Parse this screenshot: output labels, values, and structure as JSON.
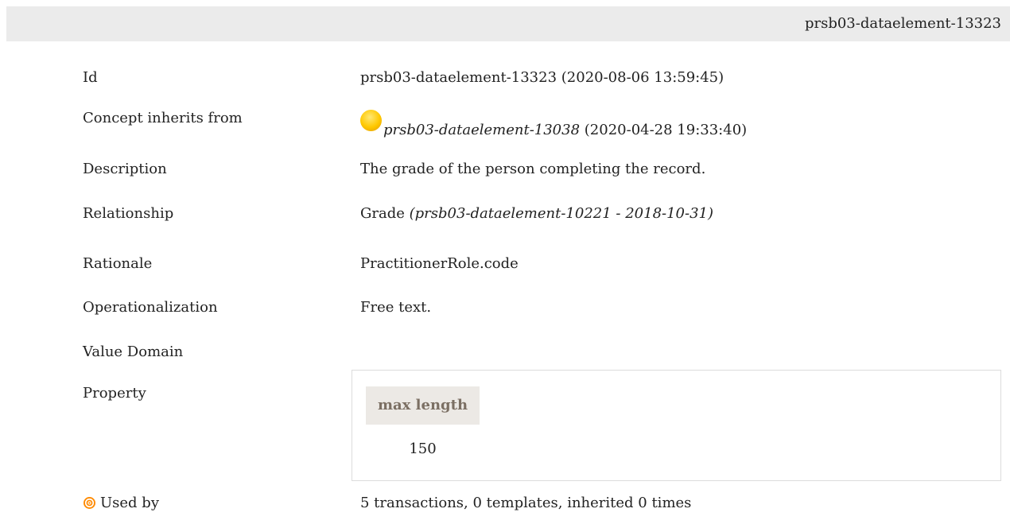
{
  "header": {
    "id": "prsb03-dataelement-13323"
  },
  "rows": {
    "id": {
      "label": "Id",
      "value": "prsb03-dataelement-13323 (2020-08-06 13:59:45)"
    },
    "inherits": {
      "label": "Concept inherits from",
      "icon": "concept-orange-circle-icon",
      "link": "prsb03-dataelement-13038",
      "date": "(2020-04-28 19:33:40)"
    },
    "description": {
      "label": "Description",
      "value": "The grade of the person completing the record."
    },
    "relationship": {
      "label": "Relationship",
      "value": "Grade",
      "detail": "(prsb03-dataelement-10221 - 2018-10-31)"
    },
    "rationale": {
      "label": "Rationale",
      "value": "PractitionerRole.code"
    },
    "operationalization": {
      "label": "Operationalization",
      "value": "Free text."
    },
    "value_domain": {
      "label": "Value Domain"
    },
    "property": {
      "label": "Property",
      "column_header": "max length",
      "column_value": "150"
    },
    "used_by": {
      "icon": "target-icon",
      "label": "Used by",
      "value": "5 transactions, 0 templates, inherited 0 times"
    }
  },
  "colors": {
    "header_bg": "#ebebeb",
    "property_header_bg": "#ece9e5",
    "property_header_text": "#7b6f63",
    "target_icon": "#ff8a00"
  }
}
